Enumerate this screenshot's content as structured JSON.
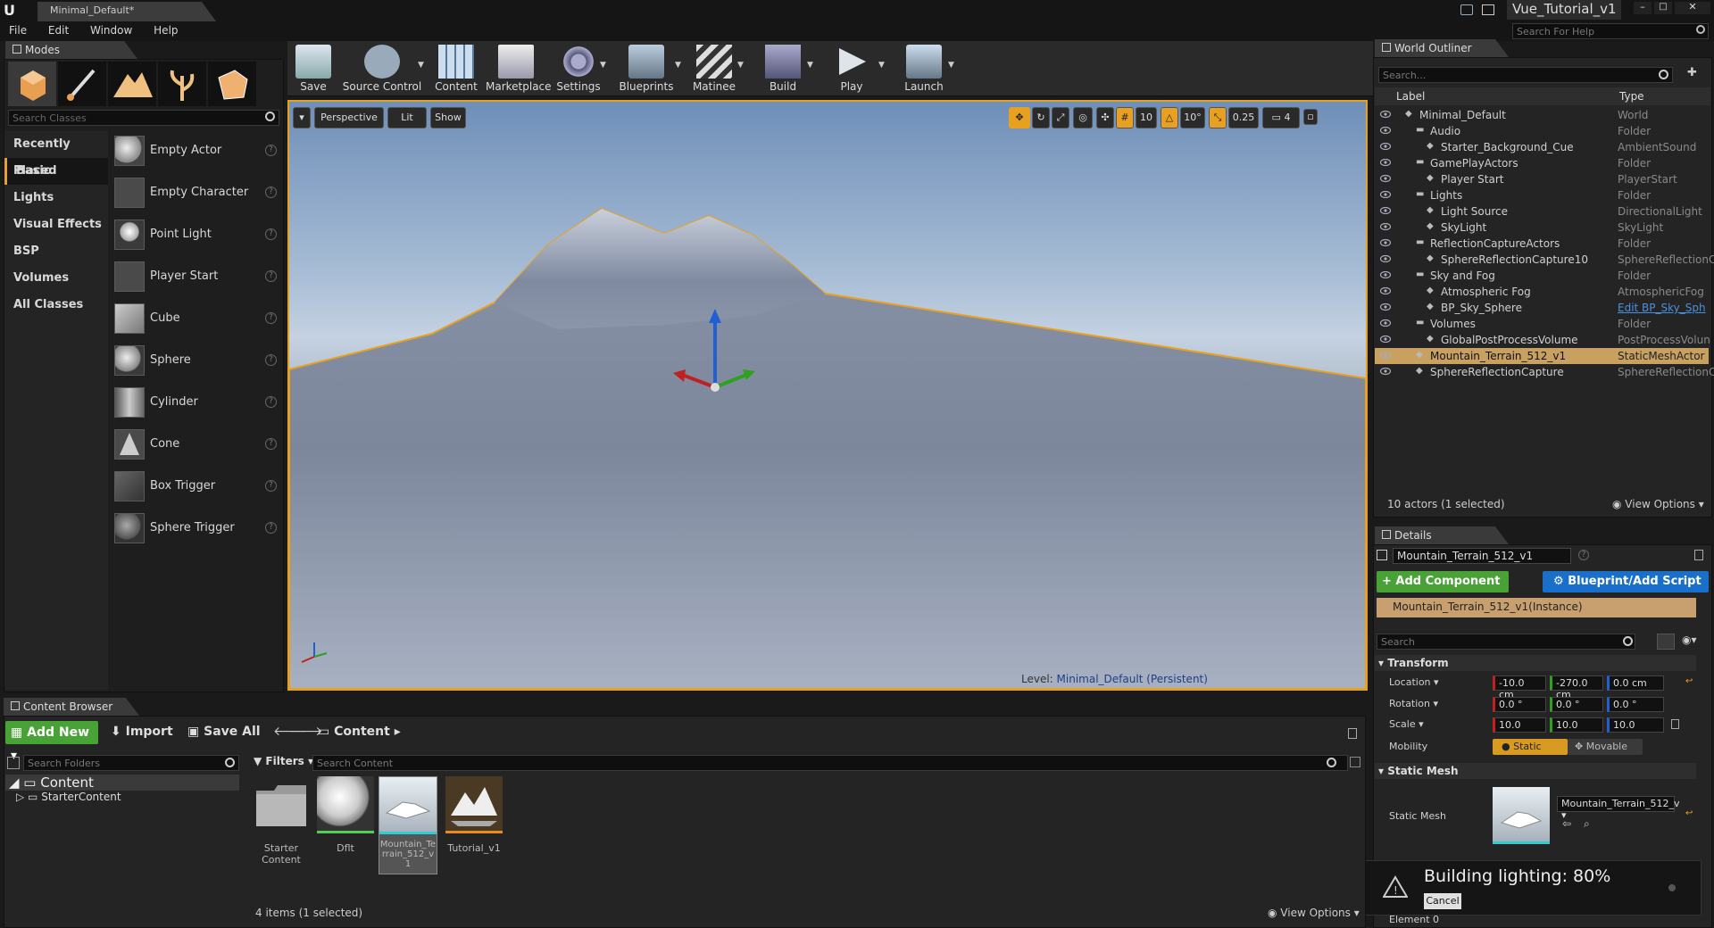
{
  "window": {
    "tab_title": "Minimal_Default*",
    "project_title": "Vue_Tutorial_v1",
    "search_help_placeholder": "Search For Help"
  },
  "menu": [
    "File",
    "Edit",
    "Window",
    "Help"
  ],
  "modes": {
    "tab": "Modes",
    "search_placeholder": "Search Classes",
    "categories": [
      "Recently Placed",
      "Basic",
      "Lights",
      "Visual Effects",
      "BSP",
      "Volumes",
      "All Classes"
    ],
    "items": [
      "Empty Actor",
      "Empty Character",
      "Point Light",
      "Player Start",
      "Cube",
      "Sphere",
      "Cylinder",
      "Cone",
      "Box Trigger",
      "Sphere Trigger"
    ]
  },
  "toolbar": [
    {
      "label": "Save",
      "icon": "save-icon"
    },
    {
      "label": "Source Control",
      "icon": "source-control-icon"
    },
    {
      "label": "Content",
      "icon": "content-icon"
    },
    {
      "label": "Marketplace",
      "icon": "marketplace-icon"
    },
    {
      "label": "Settings",
      "icon": "settings-icon"
    },
    {
      "label": "Blueprints",
      "icon": "blueprints-icon"
    },
    {
      "label": "Matinee",
      "icon": "matinee-icon"
    },
    {
      "label": "Build",
      "icon": "build-icon"
    },
    {
      "label": "Play",
      "icon": "play-icon"
    },
    {
      "label": "Launch",
      "icon": "launch-icon"
    }
  ],
  "viewport": {
    "perspective": "Perspective",
    "lit": "Lit",
    "show": "Show",
    "grid_snap": "10",
    "rot_snap": "10°",
    "scale_snap": "0.25",
    "cam_speed": "4",
    "level_label": "Level:",
    "level_name": "Minimal_Default (Persistent)"
  },
  "outliner": {
    "tab": "World Outliner",
    "search_placeholder": "Search...",
    "col_label": "Label",
    "col_type": "Type",
    "rows": [
      {
        "label": "Minimal_Default",
        "type": "World",
        "depth": 0
      },
      {
        "label": "Audio",
        "type": "Folder",
        "depth": 1
      },
      {
        "label": "Starter_Background_Cue",
        "type": "AmbientSound",
        "depth": 2
      },
      {
        "label": "GamePlayActors",
        "type": "Folder",
        "depth": 1
      },
      {
        "label": "Player Start",
        "type": "PlayerStart",
        "depth": 2
      },
      {
        "label": "Lights",
        "type": "Folder",
        "depth": 1
      },
      {
        "label": "Light Source",
        "type": "DirectionalLight",
        "depth": 2
      },
      {
        "label": "SkyLight",
        "type": "SkyLight",
        "depth": 2
      },
      {
        "label": "ReflectionCaptureActors",
        "type": "Folder",
        "depth": 1
      },
      {
        "label": "SphereReflectionCapture10",
        "type": "SphereReflectionC",
        "depth": 2
      },
      {
        "label": "Sky and Fog",
        "type": "Folder",
        "depth": 1
      },
      {
        "label": "Atmospheric Fog",
        "type": "AtmosphericFog",
        "depth": 2
      },
      {
        "label": "BP_Sky_Sphere",
        "type": "Edit BP_Sky_Sph",
        "depth": 2
      },
      {
        "label": "Volumes",
        "type": "Folder",
        "depth": 1
      },
      {
        "label": "GlobalPostProcessVolume",
        "type": "PostProcessVolun",
        "depth": 2
      },
      {
        "label": "Mountain_Terrain_512_v1",
        "type": "StaticMeshActor",
        "depth": 1
      },
      {
        "label": "SphereReflectionCapture",
        "type": "SphereReflectionC",
        "depth": 1
      }
    ],
    "selected_index": 15,
    "status": "10 actors (1 selected)",
    "view_options": "View Options"
  },
  "details": {
    "tab": "Details",
    "actor_name": "Mountain_Terrain_512_v1",
    "add_component": "+ Add Component",
    "blueprint_button": "Blueprint/Add Script",
    "instance": "Mountain_Terrain_512_v1(Instance)",
    "search_placeholder": "Search",
    "transform_header": "Transform",
    "location_label": "Location",
    "location": [
      "-10.0 cm",
      "-270.0 cm",
      "0.0 cm"
    ],
    "rotation_label": "Rotation",
    "rotation": [
      "0.0 °",
      "0.0 °",
      "0.0 °"
    ],
    "scale_label": "Scale",
    "scale": [
      "10.0",
      "10.0",
      "10.0"
    ],
    "mobility_label": "Mobility",
    "mobility_static": "Static",
    "mobility_movable": "Movable",
    "static_mesh_header": "Static Mesh",
    "static_mesh_label": "Static Mesh",
    "static_mesh_value": "Mountain_Terrain_512_v",
    "element0": "Element 0"
  },
  "lighting": {
    "text": "Building lighting:  80%",
    "cancel": "Cancel",
    "percent": 80
  },
  "content_browser": {
    "tab": "Content Browser",
    "add_new": "Add New",
    "import": "Import",
    "save_all": "Save All",
    "path": "Content",
    "search_folders": "Search Folders",
    "filters": "Filters",
    "search_content": "Search Content",
    "tree": [
      "Content",
      "StarterContent"
    ],
    "assets": [
      {
        "name": "Starter Content",
        "kind": "folder"
      },
      {
        "name": "Dflt",
        "kind": "material"
      },
      {
        "name": "Mountain_Terrain_512_v1",
        "kind": "mesh"
      },
      {
        "name": "Tutorial_v1",
        "kind": "map"
      }
    ],
    "status": "4 items (1 selected)",
    "view_options": "View Options"
  },
  "colors": {
    "accent": "#f0a018",
    "selection": "#c8a060",
    "add_green": "#49a236",
    "blueprint_blue": "#1a6fc9"
  }
}
